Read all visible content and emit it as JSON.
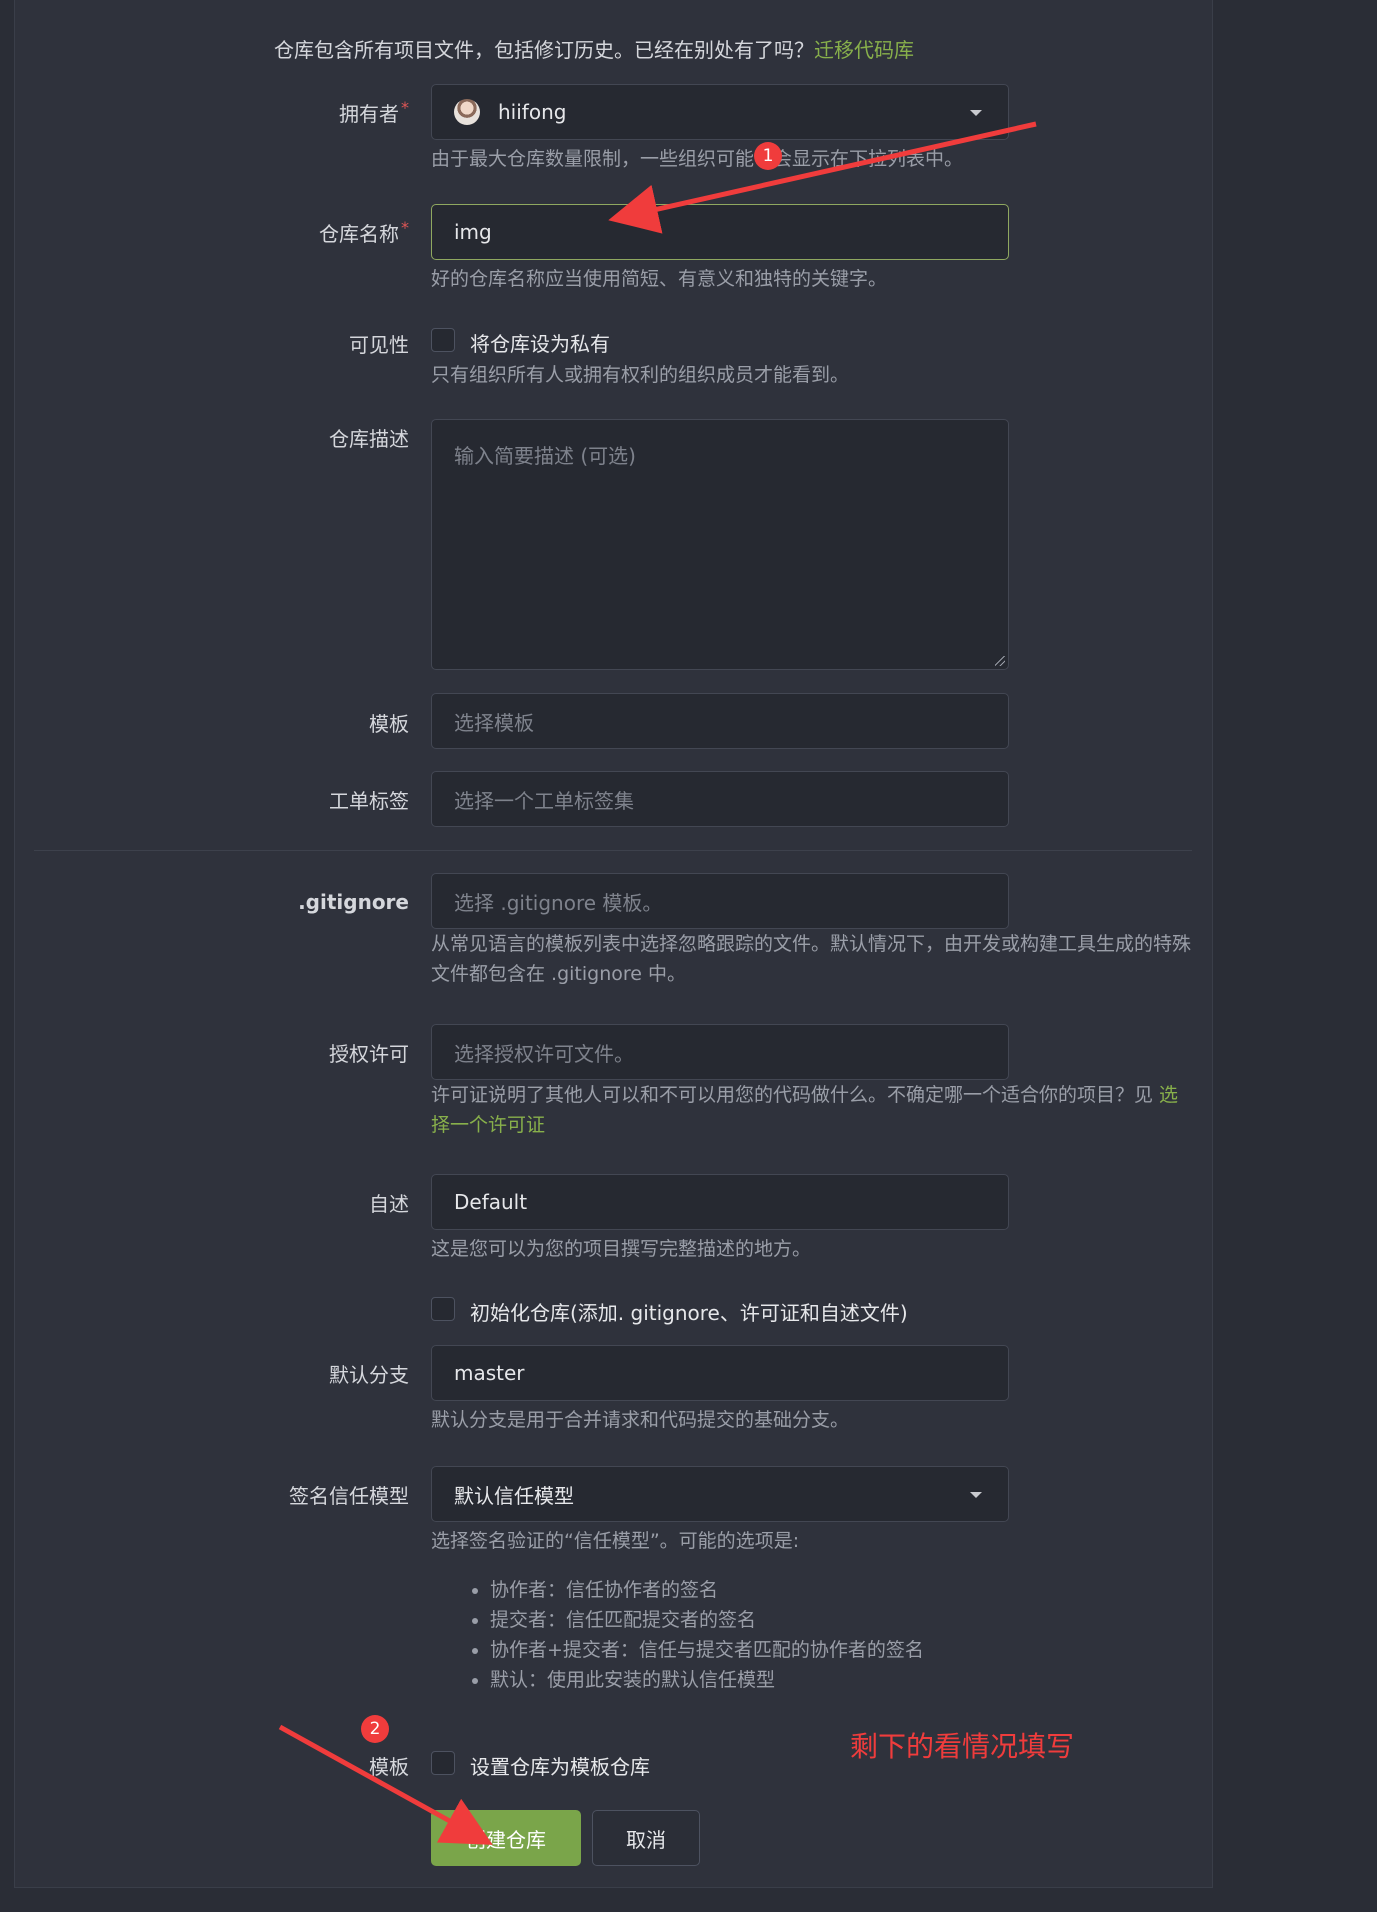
{
  "intro": {
    "text": "仓库包含所有项目文件，包括修订历史。已经在别处有了吗？",
    "link": "迁移代码库"
  },
  "owner": {
    "label": "拥有者",
    "required": "*",
    "value": "hiifong",
    "help": "由于最大仓库数量限制，一些组织可能不会显示在下拉列表中。"
  },
  "repo_name": {
    "label": "仓库名称",
    "required": "*",
    "value": "img",
    "help": "好的仓库名称应当使用简短、有意义和独特的关键字。"
  },
  "visibility": {
    "label": "可见性",
    "checkbox_label": "将仓库设为私有",
    "checked": false,
    "help": "只有组织所有人或拥有权利的组织成员才能看到。"
  },
  "description": {
    "label": "仓库描述",
    "placeholder": "输入简要描述 (可选)"
  },
  "template": {
    "label": "模板",
    "placeholder": "选择模板"
  },
  "issue_labels": {
    "label": "工单标签",
    "placeholder": "选择一个工单标签集"
  },
  "gitignore": {
    "label": ".gitignore",
    "placeholder": "选择 .gitignore 模板。",
    "help": "从常见语言的模板列表中选择忽略跟踪的文件。默认情况下，由开发或构建工具生成的特殊文件都包含在 .gitignore 中。"
  },
  "license": {
    "label": "授权许可",
    "placeholder": "选择授权许可文件。",
    "help": "许可证说明了其他人可以和不可以用您的代码做什么。不确定哪一个适合你的项目？见 ",
    "help_link": "选择一个许可证"
  },
  "readme": {
    "label": "自述",
    "value": "Default",
    "help": "这是您可以为您的项目撰写完整描述的地方。"
  },
  "auto_init": {
    "checkbox_label": "初始化仓库(添加. gitignore、许可证和自述文件)",
    "checked": false
  },
  "default_branch": {
    "label": "默认分支",
    "value": "master",
    "help": "默认分支是用于合并请求和代码提交的基础分支。"
  },
  "trust_model": {
    "label": "签名信任模型",
    "value": "默认信任模型",
    "help": "选择签名验证的“信任模型”。可能的选项是:",
    "options": [
      "协作者：信任协作者的签名",
      "提交者：信任匹配提交者的签名",
      "协作者+提交者：信任与提交者匹配的协作者的签名",
      "默认：使用此安装的默认信任模型"
    ]
  },
  "is_template": {
    "label": "模板",
    "checkbox_label": "设置仓库为模板仓库",
    "checked": false
  },
  "buttons": {
    "create": "创建仓库",
    "cancel": "取消"
  },
  "annotations": {
    "marker1": "1",
    "marker2": "2",
    "note": "剩下的看情况填写",
    "color": "#f03c3c"
  },
  "colors": {
    "accent": "#7aa54a",
    "link": "#88b04b",
    "background": "#2f323c"
  }
}
